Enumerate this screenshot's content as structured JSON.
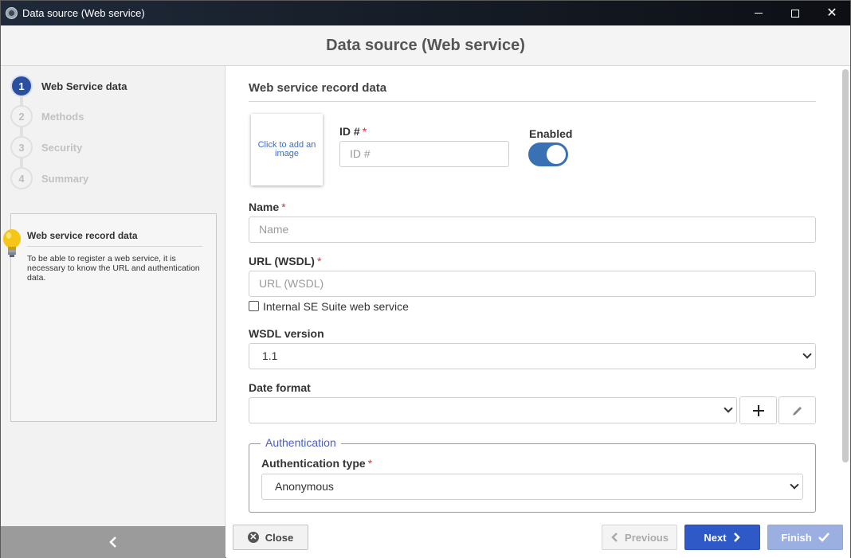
{
  "window": {
    "title": "Data source (Web service)"
  },
  "header": {
    "title": "Data source (Web service)"
  },
  "steps": [
    {
      "num": "1",
      "label": "Web Service data"
    },
    {
      "num": "2",
      "label": "Methods"
    },
    {
      "num": "3",
      "label": "Security"
    },
    {
      "num": "4",
      "label": "Summary"
    }
  ],
  "help": {
    "title": "Web service record data",
    "text": "To be able to register a web service, it is necessary to know the URL and authentication data."
  },
  "form": {
    "section_title": "Web service record data",
    "image_placeholder": "Click to add an image",
    "id_label": "ID #",
    "id_placeholder": "ID #",
    "enabled_label": "Enabled",
    "enabled": true,
    "required_mark": "*",
    "name_label": "Name",
    "name_placeholder": "Name",
    "url_label": "URL (WSDL)",
    "url_placeholder": "URL (WSDL)",
    "internal_label": "Internal SE Suite web service",
    "wsdl_label": "WSDL version",
    "wsdl_value": "1.1",
    "date_label": "Date format",
    "date_value": "",
    "auth_legend": "Authentication",
    "auth_type_label": "Authentication type",
    "auth_type_value": "Anonymous"
  },
  "footer": {
    "close": "Close",
    "previous": "Previous",
    "next": "Next",
    "finish": "Finish"
  },
  "colors": {
    "accent": "#2f59c6",
    "step_active": "#2b4fa0",
    "required": "#d9333f"
  }
}
